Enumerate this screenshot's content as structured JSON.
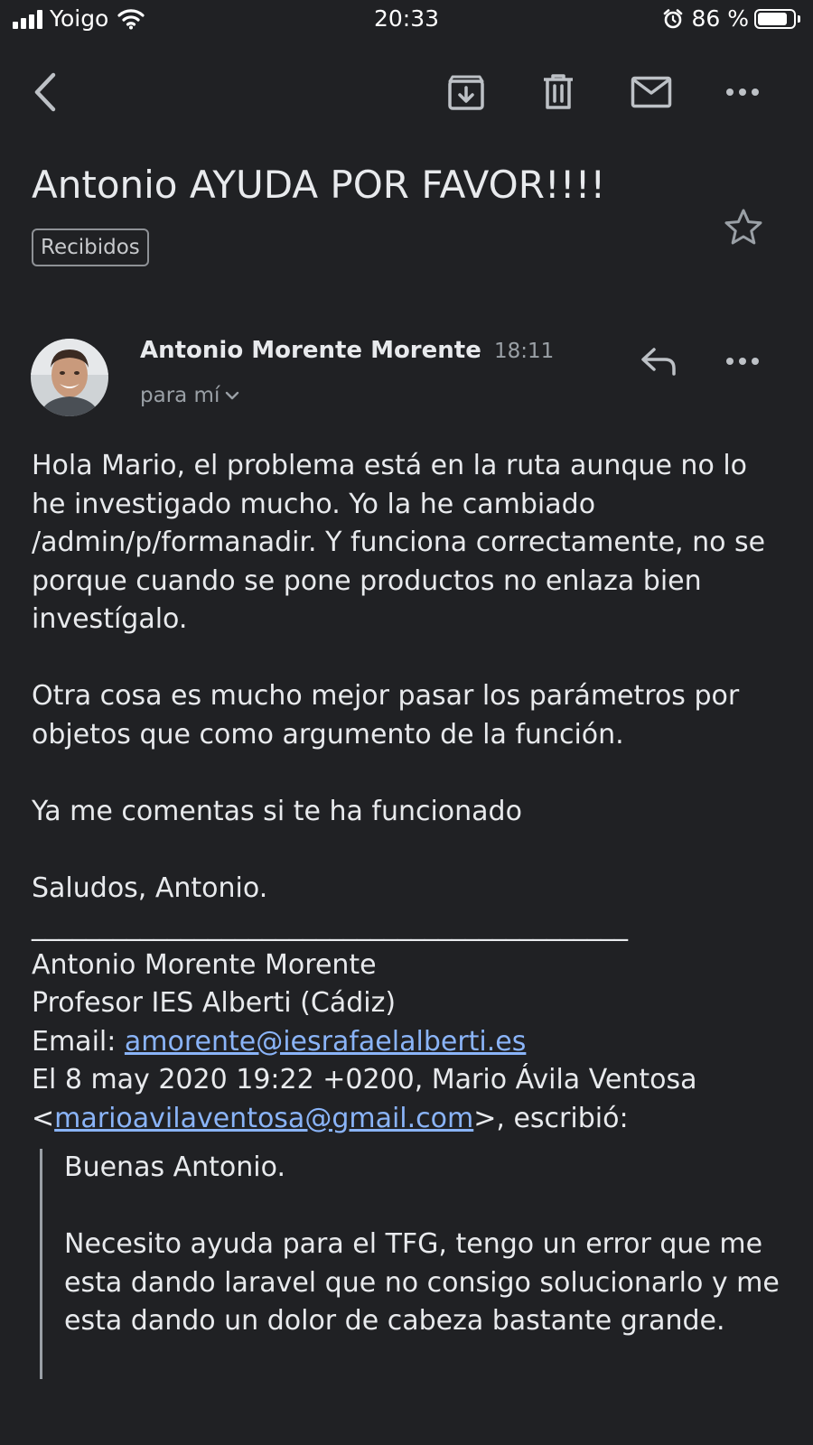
{
  "status_bar": {
    "carrier": "Yoigo",
    "time": "20:33",
    "battery_percent": "86 %",
    "battery_level": 0.86
  },
  "toolbar": {
    "icons": [
      "back-arrow-icon",
      "archive-icon",
      "trash-icon",
      "mail-icon",
      "more-icon"
    ]
  },
  "email": {
    "subject": "Antonio AYUDA POR FAVOR!!!!",
    "label": "Recibidos",
    "sender": "Antonio Morente Morente",
    "time": "18:11",
    "recipient": "para mí",
    "body": {
      "paragraph1": "Hola Mario, el problema está en la ruta aunque no lo he investigado mucho. Yo la he cambiado /admin/p/formanadir. Y funciona correctamente, no se porque cuando se pone productos no enlaza bien investígalo.",
      "paragraph2": "Otra cosa es mucho mejor pasar los parámetros por objetos que como argumento de la función.",
      "paragraph3": "Ya me comentas si te ha funcionado",
      "paragraph4": "Saludos, Antonio."
    },
    "signature": {
      "rule": "____________________________________________",
      "name": "Antonio Morente Morente",
      "title": "Profesor IES Alberti (Cádiz)",
      "email_label": "Email: ",
      "email": "amorente@iesrafaelalberti.es",
      "reply_header_prefix": "El 8 may 2020 19:22 +0200, Mario Ávila Ventosa",
      "reply_open": "<",
      "reply_email": "marioavilaventosa@gmail.com",
      "reply_suffix": ">, escribió:"
    },
    "quoted": {
      "line1": "Buenas Antonio.",
      "paragraph2": "Necesito ayuda para el TFG, tengo un error que me esta dando laravel que no consigo solucionarlo y me esta dando un dolor de cabeza bastante grande."
    }
  },
  "colors": {
    "background": "#202124",
    "text": "#e8eaed",
    "secondary": "#9aa0a6",
    "link": "#8ab4f8"
  }
}
